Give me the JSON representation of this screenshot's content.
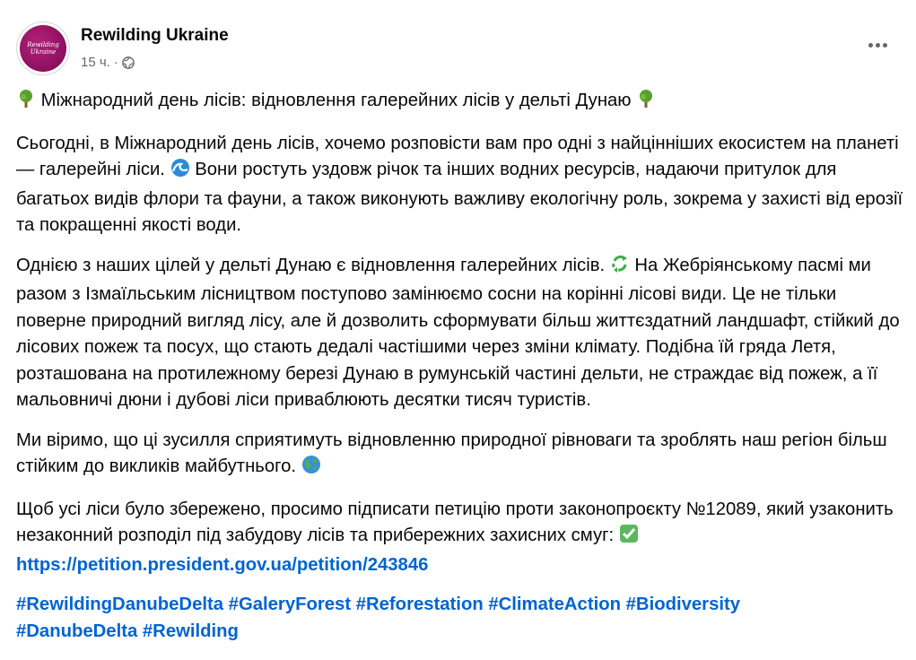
{
  "post": {
    "author": "Rewilding Ukraine",
    "avatar_text": "Rewilding Ukraine",
    "time": "15 ч.",
    "separator": "·",
    "title": "Міжнародний день лісів: відновлення галерейних лісів у дельті Дунаю",
    "para1_a": "Сьогодні, в Міжнародний день лісів, хочемо розповісти вам про одні з найцінніших екосистем на планеті — галерейні ліси.",
    "para1_b": "Вони ростуть уздовж річок та інших водних ресурсів, надаючи притулок для багатьох видів флори та фауни, а також виконують важливу екологічну роль, зокрема у захисті від ерозії та покращенні якості води.",
    "para2_a": "Однією з наших цілей у дельті Дунаю є відновлення галерейних лісів.",
    "para2_b": "На Жебріянському пасмі ми разом з Ізмаїльським лісництвом поступово замінюємо сосни на корінні лісові види. Це не тільки поверне природний вигляд лісу, але й дозволить сформувати більш життєздатний ландшафт, стійкий до лісових пожеж та посух, що стають дедалі частішими через зміни клімату. Подібна їй гряда Летя, розташована на протилежному березі Дунаю в румунській частині дельти, не страждає від пожеж, а її мальовничі дюни і дубові ліси приваблюють десятки тисяч туристів.",
    "para3": "Ми віримо, що ці зусилля сприятимуть відновленню природної рівноваги та зроблять наш регіон більш стійким до викликів майбутнього.",
    "para4": "Щоб усі ліси було збережено, просимо підписати петицію проти законопроєкту №12089, який узаконить незаконний розподіл під забудову лісів та прибережних захисних смуг:",
    "link": "https://petition.president.gov.ua/petition/243846",
    "hashtags": [
      "#RewildingDanubeDelta",
      "#GaleryForest",
      "#Reforestation",
      "#ClimateAction",
      "#Biodiversity",
      "#DanubeDelta",
      "#Rewilding"
    ]
  },
  "icons": {
    "title_left": "tree-icon",
    "title_right": "tree-icon",
    "wave": "wave-icon",
    "recycle": "recycle-icon",
    "earth": "globe-earth-icon",
    "check": "check-mark-icon",
    "privacy": "globe-privacy-icon",
    "more": "more-options-icon"
  },
  "colors": {
    "link": "#0064d1",
    "meta": "#65676b",
    "avatar": "#8c0f5d"
  }
}
